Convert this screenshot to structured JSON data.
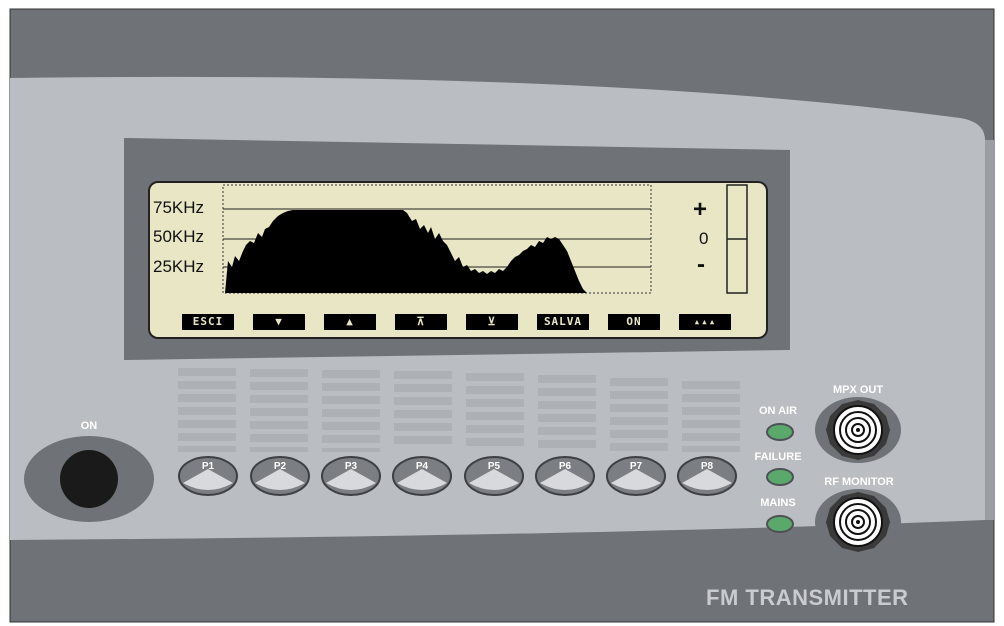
{
  "display": {
    "scale_labels": [
      "75KHz",
      "50KHz",
      "25KHz"
    ],
    "level_plus": "+",
    "level_zero": "0",
    "level_minus": "-"
  },
  "softkeys": [
    "ESCI",
    "▼",
    "▲",
    "⊼",
    "⊻",
    "SALVA",
    "ON",
    "▴▴▴"
  ],
  "presets": [
    "P1",
    "P2",
    "P3",
    "P4",
    "P5",
    "P6",
    "P7",
    "P8"
  ],
  "power": {
    "label": "ON"
  },
  "leds": {
    "on_air": "ON AIR",
    "failure": "FAILURE",
    "mains": "MAINS"
  },
  "connectors": {
    "mpx_out": "MPX OUT",
    "rf_monitor": "RF MONITOR"
  },
  "product_title": "FM TRANSMITTER",
  "colors": {
    "panel": "#babdc1",
    "dark": "#6f7276",
    "lcd": "#e8e6c4",
    "led_green": "#5aa86a"
  }
}
